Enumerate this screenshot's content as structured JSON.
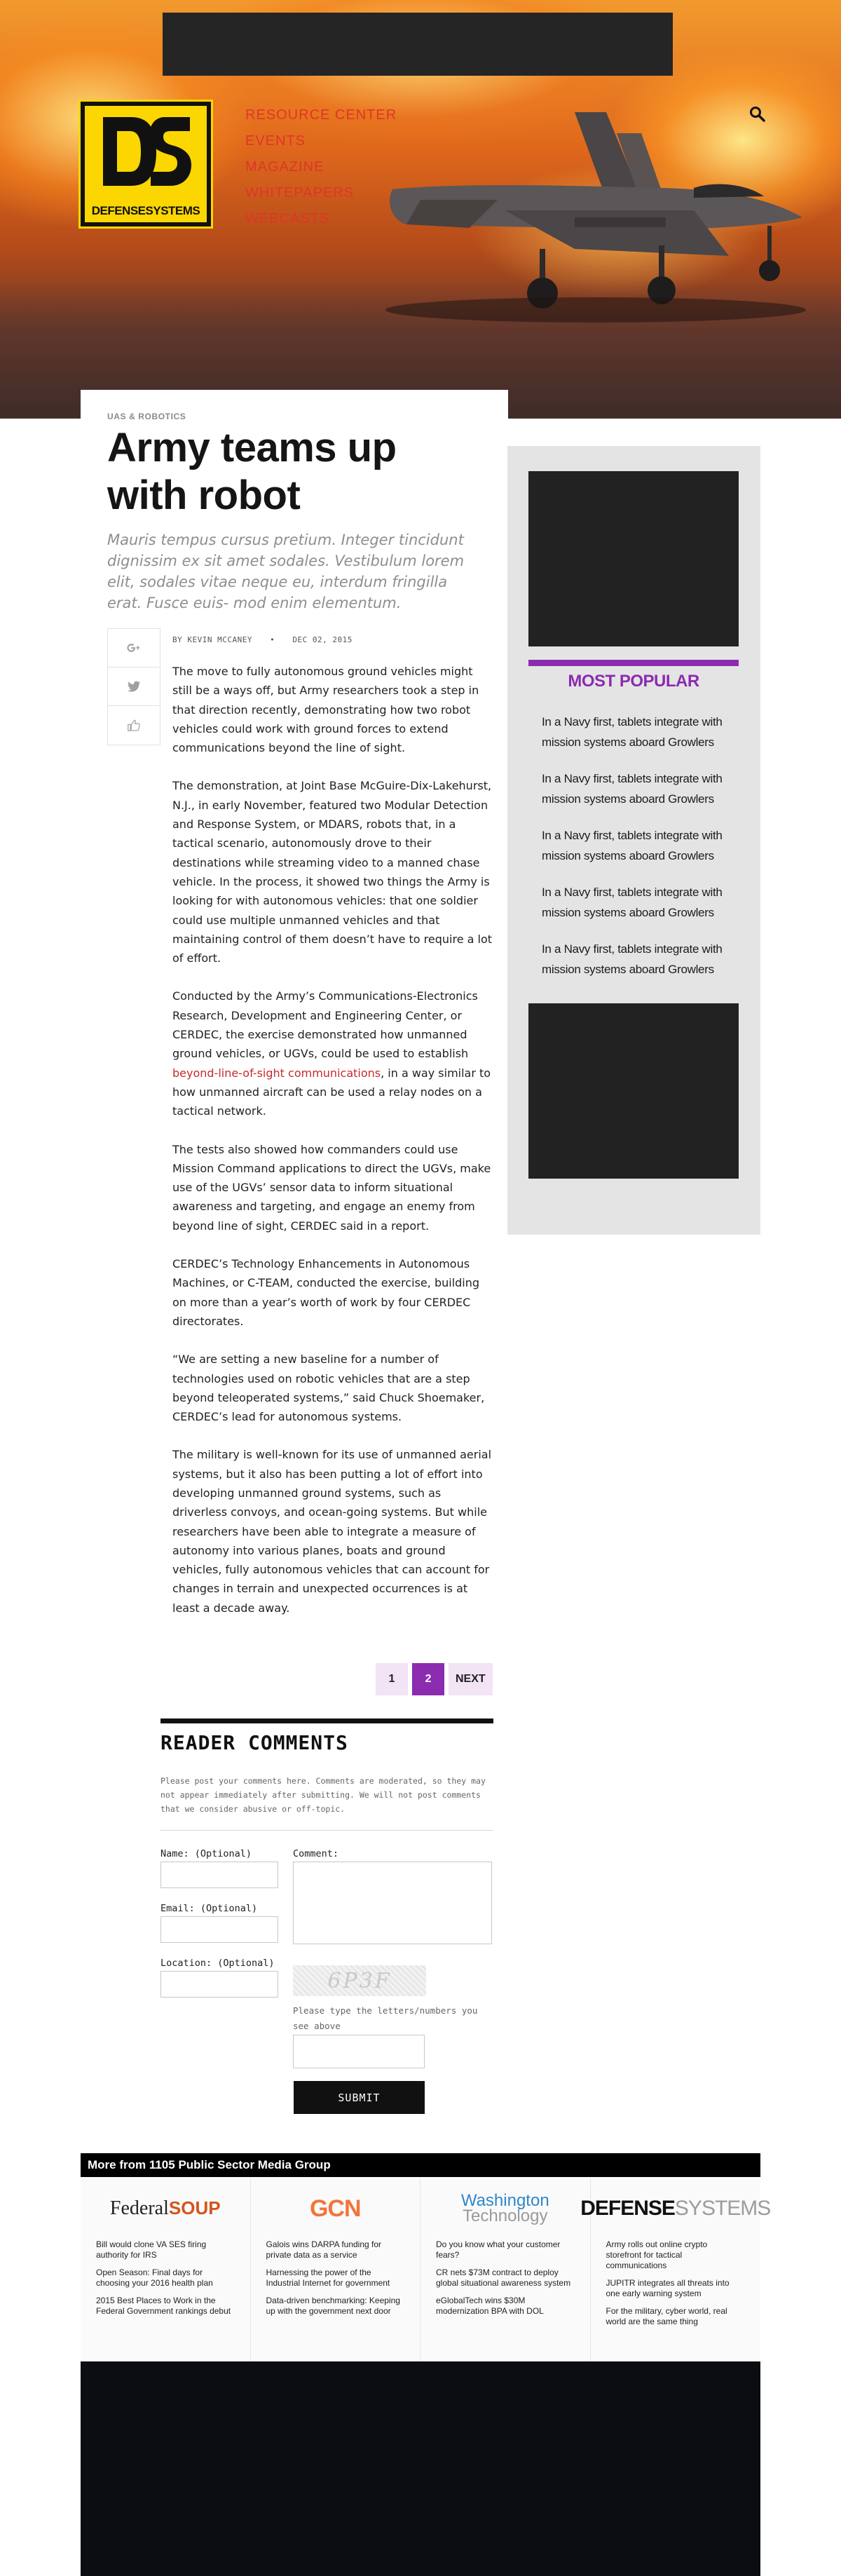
{
  "header": {
    "logo_text": "DEFENSESYSTEMS",
    "nav": [
      "RESOURCE CENTER",
      "EVENTS",
      "MAGAZINE",
      "WHITEPAPERS",
      "WEBCASTS"
    ]
  },
  "article": {
    "category": "UAS & ROBOTICS",
    "headline": "Army teams up with robot",
    "deck": "Mauris tempus cursus pretium. Integer tincidunt dignissim ex sit amet sodales. Vestibulum lorem elit, sodales vitae neque eu, interdum fringilla erat. Fusce euis- mod enim elementum.",
    "author": "BY KEVIN MCCANEY",
    "date": "DEC 02, 2015",
    "paragraphs": [
      "The move to fully autonomous ground vehicles might still be a ways off, but Army researchers took a step in that direction recently, demonstrating how two robot vehicles could work with ground forces to extend communications beyond the line of sight.",
      "The demonstration, at Joint Base McGuire-Dix-Lakehurst, N.J., in early November, featured two Modular Detection and Response System, or MDARS, robots that, in a tactical scenario, autonomously drove to their destinations while streaming video to a manned chase vehicle. In the process, it showed two things the Army is looking for with autonomous vehicles: that one soldier could use multiple unmanned vehicles and that maintaining control of them doesn’t have to require a lot of effort.",
      "Conducted by the Army’s Communications-Electronics Research, Development and Engineering Center, or CERDEC, the exercise demonstrated how unmanned ground vehicles, or UGVs, could be used to establish",
      "The tests also showed how commanders could use Mission Command applications to direct the UGVs, make use of the UGVs’ sensor data to inform situational awareness and targeting, and engage an enemy from beyond line of sight, CERDEC said in a report.",
      "CERDEC’s Technology Enhancements in Autonomous Machines, or C-TEAM, conducted the exercise, building on more than a year’s worth of work by four CERDEC directorates.",
      "“We are setting a new baseline for a number of technologies used on robotic vehicles that are a step beyond teleoperated systems,” said Chuck Shoemaker, CERDEC’s lead for autonomous systems.",
      "The military is well-known for its use of unmanned aerial systems, but it also has been putting a lot of effort into developing unmanned ground systems, such as driverless convoys, and ocean-going systems. But while researchers have been able to integrate a measure of autonomy into various planes, boats and ground vehicles, fully autonomous vehicles that can account for changes in terrain and unexpected occurrences is at least a decade away."
    ],
    "link_text": "beyond-line-of-sight communications",
    "link_tail": ", in a way similar to how unmanned aircraft can be used a relay nodes on a tactical network."
  },
  "pagination": {
    "pages": [
      "1",
      "2"
    ],
    "active": "2",
    "next_label": "NEXT"
  },
  "sidebar": {
    "popular_title": "MOST POPULAR",
    "popular_items": [
      "In a Navy first, tablets integrate with mission systems aboard Growlers",
      "In a Navy first, tablets integrate with mission systems aboard Growlers",
      "In a Navy first, tablets integrate with mission systems aboard Growlers",
      "In a Navy first, tablets integrate with mission systems aboard Growlers",
      "In a Navy first, tablets integrate with mission systems aboard Growlers"
    ]
  },
  "comments": {
    "title": "READER COMMENTS",
    "note": "Please post your comments here. Comments are moderated, so they may not appear immediately after submitting. We will not post comments that we consider abusive or off-topic.",
    "name_label": "Name: (Optional)",
    "email_label": "Email: (Optional)",
    "location_label": "Location: (Optional)",
    "comment_label": "Comment:",
    "captcha_text": "6P3F",
    "captcha_help": "Please type the letters/numbers you see above",
    "submit_label": "SUBMIT"
  },
  "network": {
    "heading": "More from 1105 Public Sector Media Group",
    "columns": [
      {
        "logo": "Federal",
        "logo_accent": "SOUP",
        "items": [
          "Bill would clone VA SES firing authority for IRS",
          "Open Season: Final days for choosing your 2016 health plan",
          "2015 Best Places to Work in the Federal Government rankings debut"
        ]
      },
      {
        "logo": "GCN",
        "items": [
          "Galois wins DARPA funding for private data as a service",
          "Harnessing the power of the Industrial Internet for government",
          "Data-driven benchmarking: Keeping up with the government next door"
        ]
      },
      {
        "logo": "Washington",
        "logo_accent": "Technology",
        "items": [
          "Do you know what your customer fears?",
          "CR nets $73M contract to deploy global situational awareness system",
          "eGlobalTech wins $30M modernization BPA with DOL"
        ]
      },
      {
        "logo": "DEFENSE",
        "logo_accent": "SYSTEMS",
        "items": [
          "Army rolls out online crypto storefront for tactical communications",
          "JUPITR integrates all threats into one early warning system",
          "For the military, cyber world, real world are the same thing"
        ]
      }
    ]
  }
}
